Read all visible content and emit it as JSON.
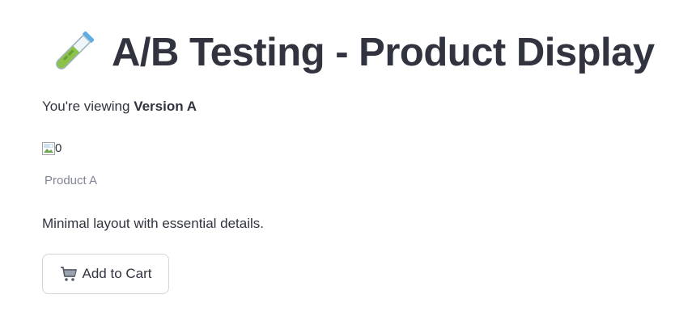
{
  "header": {
    "title": "A/B Testing - Product Display",
    "icon": "test-tube-icon"
  },
  "version": {
    "prefix": "You're viewing ",
    "label": "Version A"
  },
  "product": {
    "image_alt": "0",
    "caption": "Product A",
    "description": "Minimal layout with essential details."
  },
  "actions": {
    "add_to_cart_label": "Add to Cart",
    "add_to_cart_icon": "shopping-cart-icon"
  },
  "colors": {
    "text": "#31333f",
    "caption": "#808495",
    "button_border": "#d4d5d9"
  }
}
